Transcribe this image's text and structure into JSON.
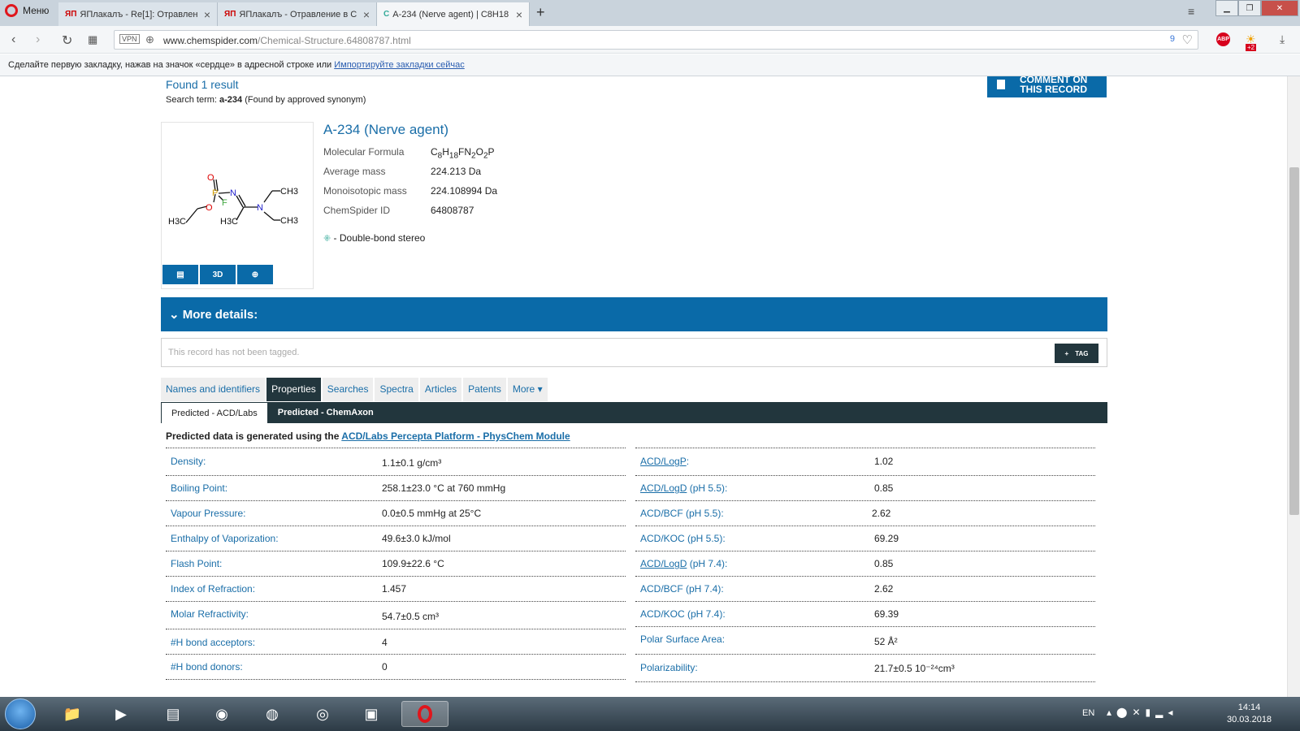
{
  "browser": {
    "menu_label": "Меню",
    "tabs": [
      {
        "favicon": "ЯП",
        "title": "ЯПлакалъ - Re[1]: Отравлен"
      },
      {
        "favicon": "ЯП",
        "title": "ЯПлакалъ - Отравление в С"
      },
      {
        "favicon": "C",
        "title": "A-234 (Nerve agent) | C8H18"
      }
    ],
    "url_domain": "www.chemspider.com",
    "url_path": "/Chemical-Structure.64808787.html",
    "vpn_label": "VPN",
    "badge_count": "9",
    "ext_badge": "+2",
    "abp_label": "ABP",
    "bookmark_hint": "Сделайте первую закладку, нажав на значок «сердце» в адресной строке или",
    "bookmark_link": "Импортируйте закладки сейчас"
  },
  "header": {
    "found": "Found 1 result",
    "search_term_prefix": "Search term: ",
    "search_term": "a-234",
    "search_term_suffix": " (Found by approved synonym)",
    "comment_line1": "COMMENT ON",
    "comment_line2": "THIS RECORD"
  },
  "record": {
    "title": "A-234 (Nerve agent)",
    "properties": [
      {
        "label": "Molecular Formula",
        "value": "C8H18FN2O2P"
      },
      {
        "label": "Average mass",
        "value": "224.213 Da"
      },
      {
        "label": "Monoisotopic mass",
        "value": "224.108994 Da"
      },
      {
        "label": "ChemSpider ID",
        "value": "64808787"
      }
    ],
    "stereo_note": " - Double-bond stereo",
    "btn_3d": "3D",
    "structure_labels": {
      "o_top": "O",
      "p": "P",
      "n1": "N",
      "f": "F",
      "o": "O",
      "n2": "N",
      "ch3_a": "CH3",
      "ch3_b": "CH3",
      "h3c_a": "H3C",
      "h3c_b": "H3C"
    }
  },
  "more_details": "More details:",
  "tag_placeholder": "This record has not been tagged.",
  "tag_button": "TAG",
  "tabs": [
    "Names and identifiers",
    "Properties",
    "Searches",
    "Spectra",
    "Articles",
    "Patents",
    "More"
  ],
  "subtabs": [
    "Predicted - ACD/Labs",
    "Predicted - ChemAxon"
  ],
  "predicted_note_prefix": "Predicted data is generated using the ",
  "predicted_note_link": "ACD/Labs Percepta Platform - PhysChem Module",
  "left_table": [
    {
      "label": "Density:",
      "value": "1.1±0.1 g/cm³"
    },
    {
      "label": "Boiling Point:",
      "value": "258.1±23.0 °C at 760 mmHg"
    },
    {
      "label": "Vapour Pressure:",
      "value": "0.0±0.5 mmHg at 25°C"
    },
    {
      "label": "Enthalpy of Vaporization:",
      "value": "49.6±3.0 kJ/mol"
    },
    {
      "label": "Flash Point:",
      "value": "109.9±22.6 °C"
    },
    {
      "label": "Index of Refraction:",
      "value": "1.457"
    },
    {
      "label": "Molar Refractivity:",
      "value": "54.7±0.5 cm³"
    },
    {
      "label": "#H bond acceptors:",
      "value": "4"
    },
    {
      "label": "#H bond donors:",
      "value": "0"
    }
  ],
  "right_table": [
    {
      "label_link": "ACD/LogP",
      "label_rest": ":",
      "value": "1.02"
    },
    {
      "label_link": "ACD/LogD",
      "label_rest": " (pH 5.5):",
      "value": "0.85"
    },
    {
      "label_link": "",
      "label_rest": "ACD/BCF (pH 5.5):",
      "value": "2.62"
    },
    {
      "label_link": "",
      "label_rest": "ACD/KOC (pH 5.5):",
      "value": "69.29"
    },
    {
      "label_link": "ACD/LogD",
      "label_rest": " (pH 7.4):",
      "value": "0.85"
    },
    {
      "label_link": "",
      "label_rest": "ACD/BCF (pH 7.4):",
      "value": "2.62"
    },
    {
      "label_link": "",
      "label_rest": "ACD/KOC (pH 7.4):",
      "value": "69.39"
    },
    {
      "label_link": "",
      "label_rest": "Polar Surface Area:",
      "value": "52 Å²"
    },
    {
      "label_link": "",
      "label_rest": "Polarizability:",
      "value": "21.7±0.5 10⁻²⁴cm³"
    }
  ],
  "taskbar": {
    "lang": "EN",
    "time": "14:14",
    "date": "30.03.2018"
  },
  "colors": {
    "accent": "#0a6aa8",
    "dark": "#22363d",
    "link": "#1a6ea8"
  }
}
